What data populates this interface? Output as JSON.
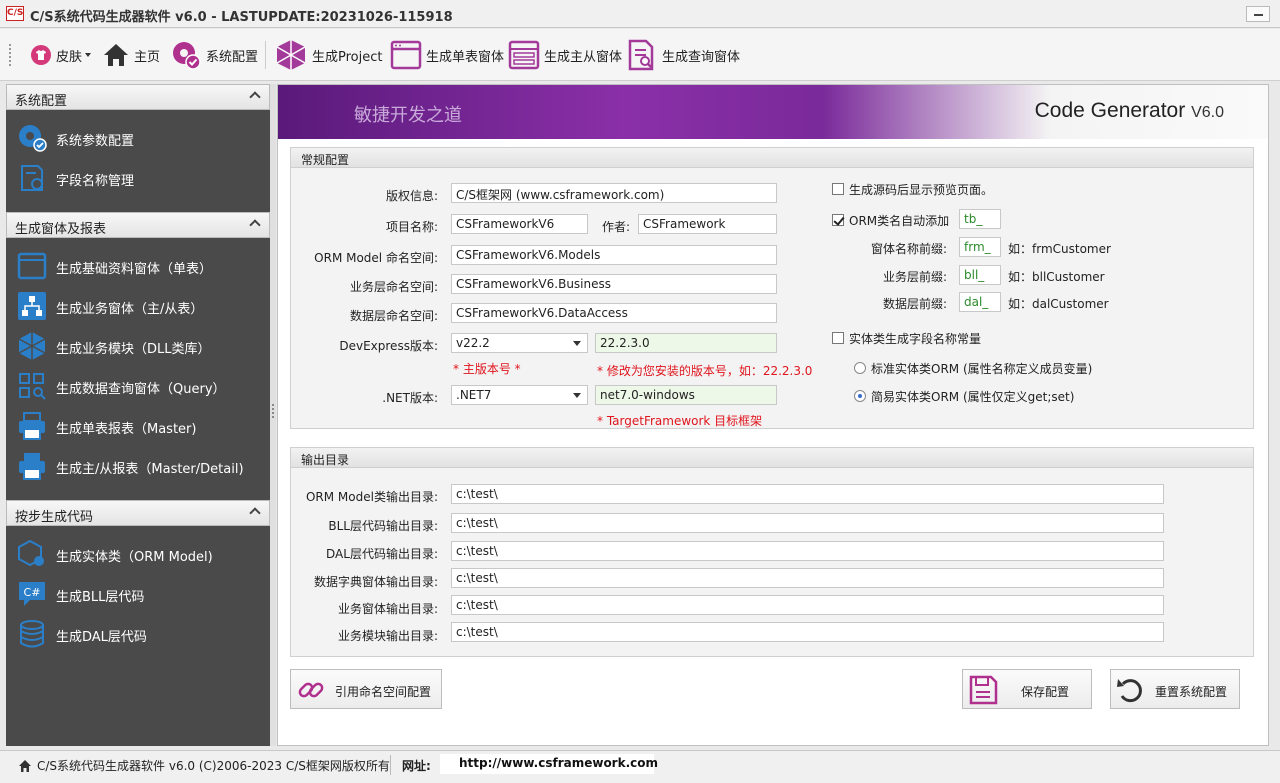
{
  "window": {
    "logo": "C/S",
    "title": "C/S系统代码生成器软件 v6.0 - LASTUPDATE:20231026-115918"
  },
  "toolbar": {
    "skin": "皮肤",
    "home": "主页",
    "system_config": "系统配置",
    "gen_project": "生成Project",
    "gen_single_form": "生成单表窗体",
    "gen_master_detail": "生成主从窗体",
    "gen_query_form": "生成查询窗体"
  },
  "sidebar": {
    "groups": [
      {
        "title": "系统配置",
        "items": [
          "系统参数配置",
          "字段名称管理"
        ]
      },
      {
        "title": "生成窗体及报表",
        "items": [
          "生成基础资料窗体（单表）",
          "生成业务窗体（主/从表）",
          "生成业务模块（DLL类库）",
          "生成数据查询窗体（Query）",
          "生成单表报表（Master)",
          "生成主/从报表（Master/Detail)"
        ]
      },
      {
        "title": "按步生成代码",
        "items": [
          "生成实体类（ORM Model)",
          "生成BLL层代码",
          "生成DAL层代码"
        ]
      }
    ]
  },
  "banner": {
    "slogan": "敏捷开发之道",
    "brand": "Code Generator",
    "version": "V6.0"
  },
  "general": {
    "title": "常规配置",
    "copyright_label": "版权信息:",
    "copyright_value": "C/S框架网 (www.csframework.com)",
    "project_label": "项目名称:",
    "project_value": "CSFrameworkV6",
    "author_label": "作者:",
    "author_value": "CSFramework",
    "orm_ns_label": "ORM Model 命名空间:",
    "orm_ns_value": "CSFrameworkV6.Models",
    "bll_ns_label": "业务层命名空间:",
    "bll_ns_value": "CSFrameworkV6.Business",
    "dal_ns_label": "数据层命名空间:",
    "dal_ns_value": "CSFrameworkV6.DataAccess",
    "devexpress_label": "DevExpress版本:",
    "devexpress_value": "v22.2",
    "devexpress_full": "22.2.3.0",
    "note_main_ver": "* 主版本号 *",
    "note_change_ver": "* 修改为您安装的版本号，如：22.2.3.0",
    "net_label": ".NET版本:",
    "net_value": ".NET7",
    "net_target": "net7.0-windows",
    "note_target": "* TargetFramework 目标框架"
  },
  "options": {
    "preview_page": "生成源码后显示预览页面。",
    "preview_checked": false,
    "orm_prefix_label": "ORM类名自动添加",
    "orm_prefix_checked": true,
    "orm_prefix_value": "tb_",
    "form_prefix_label": "窗体名称前缀:",
    "form_prefix_value": "frm_",
    "form_example": "如：frmCustomer",
    "bll_prefix_label": "业务层前缀:",
    "bll_prefix_value": "bll_",
    "bll_example": "如：bllCustomer",
    "dal_prefix_label": "数据层前缀:",
    "dal_prefix_value": "dal_",
    "dal_example": "如：dalCustomer",
    "entity_const_label": "实体类生成字段名称常量",
    "entity_const_checked": false,
    "radio_standard": "标准实体类ORM (属性名称定义成员变量)",
    "radio_simple": "简易实体类ORM (属性仅定义get;set)",
    "radio_selected": "simple"
  },
  "output": {
    "title": "输出目录",
    "rows": [
      {
        "label": "ORM Model类输出目录:",
        "value": "c:\\test\\"
      },
      {
        "label": "BLL层代码输出目录:",
        "value": "c:\\test\\"
      },
      {
        "label": "DAL层代码输出目录:",
        "value": "c:\\test\\"
      },
      {
        "label": "数据字典窗体输出目录:",
        "value": "c:\\test\\"
      },
      {
        "label": "业务窗体输出目录:",
        "value": "c:\\test\\"
      },
      {
        "label": "业务模块输出目录:",
        "value": "c:\\test\\"
      }
    ]
  },
  "buttons": {
    "ref_ns": "引用命名空间配置",
    "save": "保存配置",
    "reset": "重置系统配置"
  },
  "status": {
    "copyright": "C/S系统代码生成器软件 v6.0 (C)2006-2023 C/S框架网版权所有",
    "url_label": "网址:",
    "url": "http://www.csframework.com"
  },
  "colors": {
    "accent": "#8a2fa8",
    "nav_bg": "#4a4a4a",
    "icon_blue": "#2b7fc9",
    "note_red": "#e0151d"
  }
}
